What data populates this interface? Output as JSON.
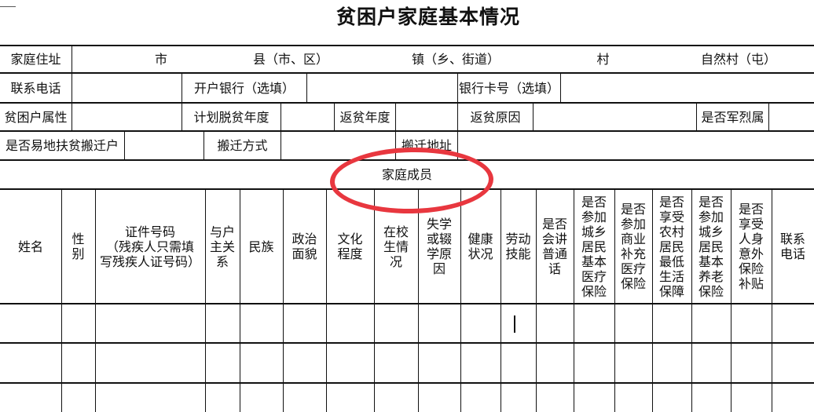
{
  "document": {
    "title": "贫困户家庭基本情况"
  },
  "household": {
    "address": {
      "label": "家庭住址",
      "city": "市",
      "county": "县（市、区）",
      "town": "镇（乡、街道）",
      "village": "村",
      "natural_village": "自然村（屯）"
    },
    "contact_row": {
      "phone_label": "联系电话",
      "phone_value": "",
      "bank_label": "开户银行（选填）",
      "bank_value": "",
      "card_label": "银行卡号（选填）",
      "card_value": ""
    },
    "status_row": {
      "attribute_label": "贫困户属性",
      "attribute_value": "",
      "plan_year_label": "计划脱贫年度",
      "plan_year_value": "",
      "return_year_label": "返贫年度",
      "return_year_value": "",
      "return_reason_label": "返贫原因",
      "return_reason_value": "",
      "military_label": "是否军烈属",
      "military_value": ""
    },
    "relocation_row": {
      "relocation_label": "是否易地扶贫搬迁户",
      "relocation_value": "",
      "method_label": "搬迁方式",
      "method_value": "",
      "address_label": "搬迁地址",
      "address_value": ""
    }
  },
  "members": {
    "section_title": "家庭成员",
    "columns": [
      "姓名",
      "性\n别",
      "证件号码\n（残疾人只需填\n写残疾人证号码）",
      "与户\n主关\n系",
      "民族",
      "政治\n面貌",
      "文化\n程度",
      "在校\n生情\n况",
      "失学\n或辍\n学原\n因",
      "健康\n状况",
      "劳动\n技能",
      "是否\n会讲\n普通\n话",
      "是否\n参加\n城乡\n居民\n基本\n医疗\n保险",
      "是否\n参加\n商业\n补充\n医疗\n保险",
      "是否\n享受\n农村\n居民\n最低\n生活\n保障",
      "是否\n参加\n城乡\n居民\n基本\n养老\n保险",
      "是否\n享受\n人身\n意外\n保险\n补贴",
      "联系\n电话"
    ],
    "rows": [
      [
        "",
        "",
        "",
        "",
        "",
        "",
        "",
        "",
        "",
        "",
        "",
        "",
        "",
        "",
        "",
        "",
        "",
        ""
      ],
      [
        "",
        "",
        "",
        "",
        "",
        "",
        "",
        "",
        "",
        "",
        "",
        "",
        "",
        "",
        "",
        "",
        "",
        ""
      ],
      [
        "",
        "",
        "",
        "",
        "",
        "",
        "",
        "",
        "",
        "",
        "",
        "",
        "",
        "",
        "",
        "",
        "",
        ""
      ]
    ]
  },
  "annotation": {
    "highlight_color": "#e8373f",
    "highlight_target": "家庭成员"
  }
}
